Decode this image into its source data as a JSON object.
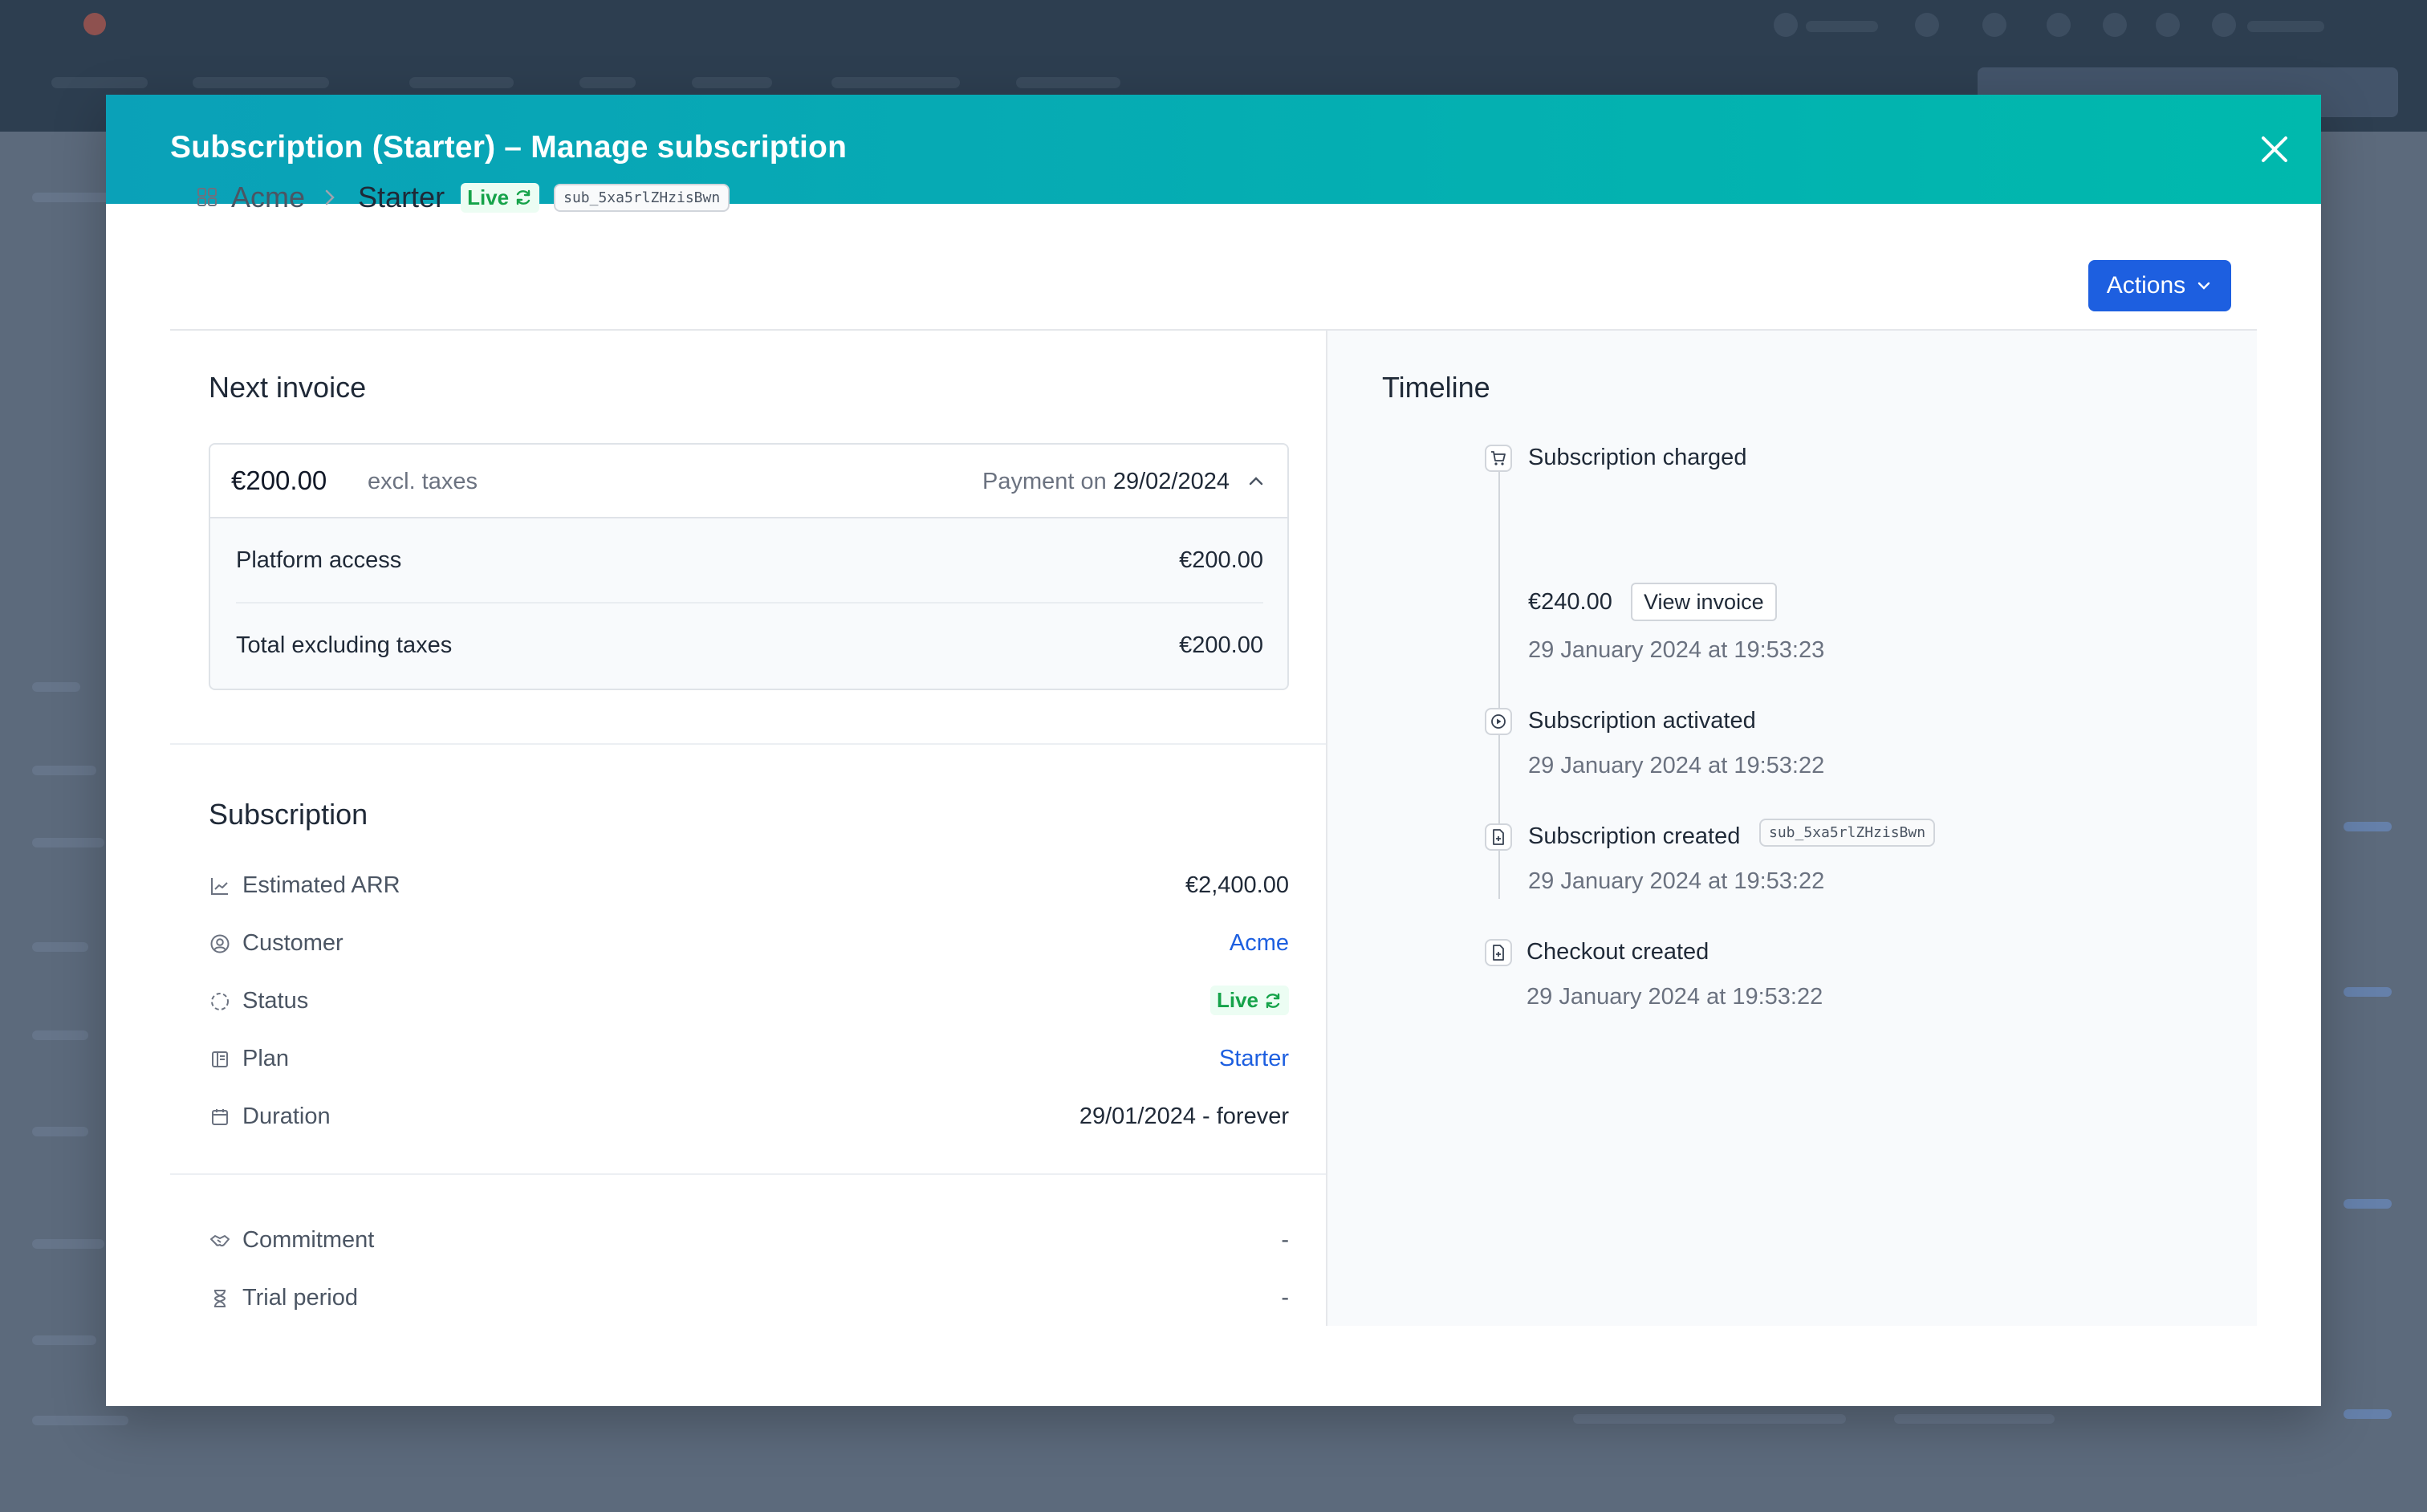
{
  "modal": {
    "title": "Subscription (Starter) – Manage subscription"
  },
  "breadcrumb": {
    "company": "Acme",
    "plan": "Starter",
    "status": "Live",
    "subscription_id": "sub_5xa5rlZHzisBwn"
  },
  "actions_label": "Actions",
  "next_invoice": {
    "title": "Next invoice",
    "amount": "€200.00",
    "taxes_note": "excl. taxes",
    "payment_prefix": "Payment on",
    "payment_date": "29/02/2024",
    "lines": [
      {
        "label": "Platform access",
        "value": "€200.00"
      },
      {
        "label": "Total excluding taxes",
        "value": "€200.00"
      }
    ]
  },
  "subscription": {
    "title": "Subscription",
    "properties": [
      {
        "label": "Estimated ARR",
        "value": "€2,400.00",
        "icon": "chart-icon"
      },
      {
        "label": "Customer",
        "value": "Acme",
        "icon": "user-circle-icon"
      },
      {
        "label": "Status",
        "value": "Live",
        "icon": "status-dashed-circle-icon"
      },
      {
        "label": "Plan",
        "value": "Starter",
        "icon": "book-icon"
      },
      {
        "label": "Duration",
        "value": "29/01/2024 - forever",
        "icon": "calendar-icon"
      }
    ],
    "extra": [
      {
        "label": "Commitment",
        "value": "-",
        "icon": "handshake-icon"
      },
      {
        "label": "Trial period",
        "value": "-",
        "icon": "hourglass-icon"
      }
    ]
  },
  "timeline": {
    "title": "Timeline",
    "events": [
      {
        "title": "Subscription charged",
        "amount": "€240.00",
        "button": "View invoice",
        "time": "29 January 2024 at 19:53:23",
        "icon": "cart-icon"
      },
      {
        "title": "Subscription activated",
        "time": "29 January 2024 at 19:53:22",
        "icon": "play-circle-icon"
      },
      {
        "title": "Subscription created",
        "chip": "sub_5xa5rlZHzisBwn",
        "time": "29 January 2024 at 19:53:22",
        "icon": "file-icon"
      },
      {
        "title": "Checkout created",
        "time": "29 January 2024 at 19:53:22",
        "icon": "file-icon"
      }
    ]
  },
  "colors": {
    "header_gradient_start": "#0aa1b8",
    "header_gradient_end": "#00b9ad",
    "primary": "#1d5fe0",
    "live_green": "#16a34a",
    "backdrop": "#5d6b7e"
  }
}
